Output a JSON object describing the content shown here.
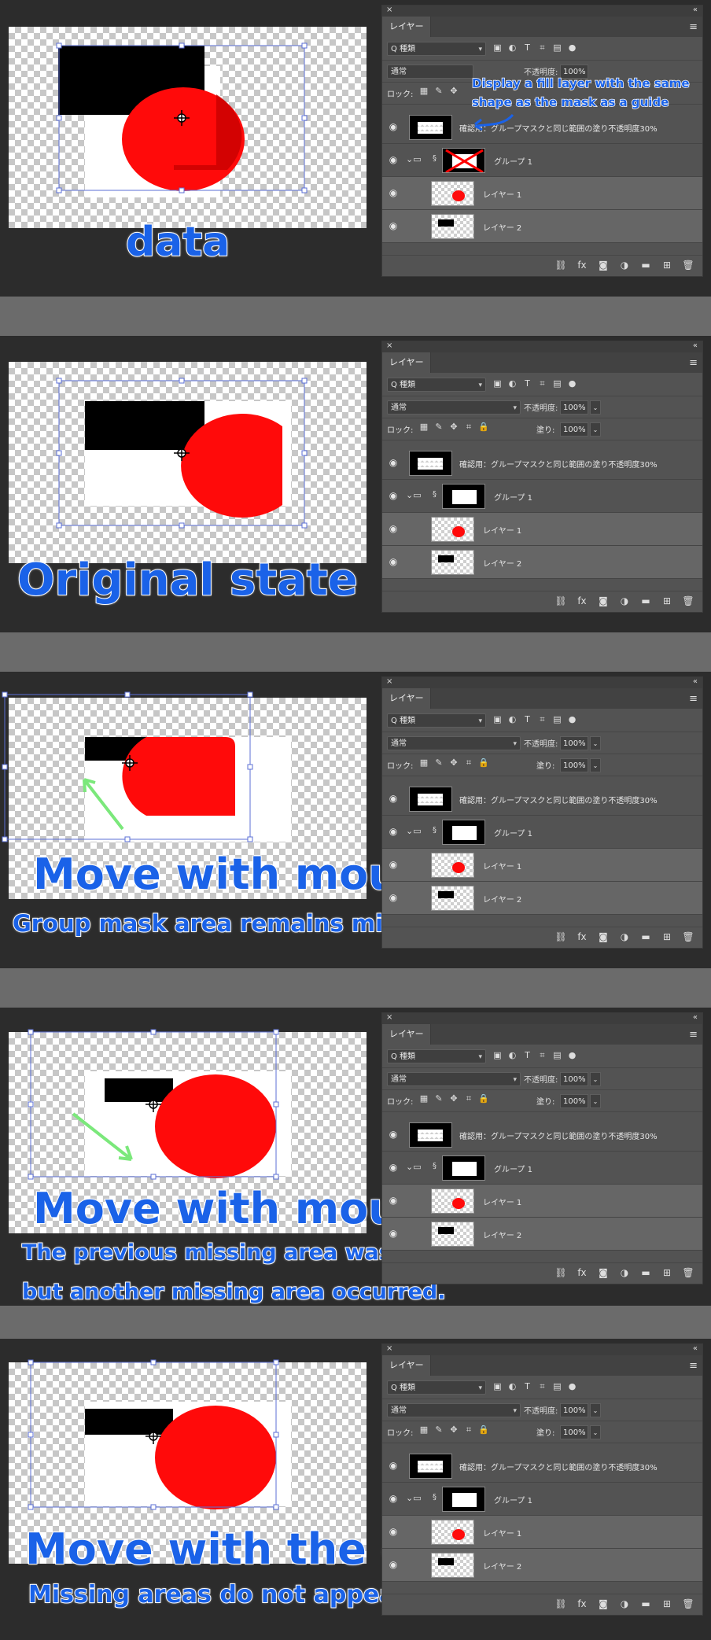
{
  "layers_panel": {
    "close": "×",
    "collapse": "«",
    "tab": "レイヤー",
    "menu": "≡",
    "filter_kind": "Q 種類",
    "blend_mode": "通常",
    "opacity_label": "不透明度:",
    "opacity_value": "100%",
    "lock_label": "ロック:",
    "fill_label": "塗り:",
    "fill_value": "100%",
    "layers": {
      "guide": "確認用：グループマスクと同じ範囲の塗り不透明度30%",
      "group": "グループ 1",
      "layer1": "レイヤー 1",
      "layer2": "レイヤー 2"
    }
  },
  "captions": {
    "p1_title": "data",
    "p1_note_line1": "Display a fill layer with the same",
    "p1_note_line2": "shape as the mask as a guide",
    "p2_title": "Original state",
    "p3_title": "Move with mouse",
    "p3_sub": "Group mask area remains missing.",
    "p4_title": "Move with mouse",
    "p4_sub1": "The previous missing area was displayed,",
    "p4_sub2": "but another missing area occurred.",
    "p5_title": "Move with the cursor keys",
    "p5_sub": "Missing areas do not appear."
  },
  "colors": {
    "caption_blue": "#1a62e8",
    "art_red": "#ff0a0a",
    "selection_blue": "#5b6fd6",
    "arrow_green": "#7be87b"
  },
  "icons": {
    "eye": "eye-icon",
    "folder": "folder-icon",
    "chain": "chain-link-icon",
    "trash": "trash-icon",
    "cursor": "move-cursor-icon"
  }
}
